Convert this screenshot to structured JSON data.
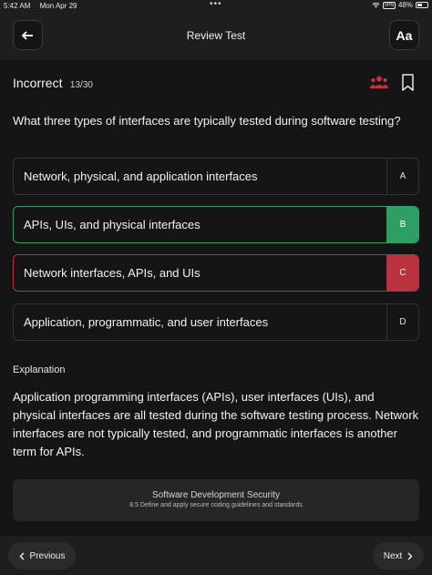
{
  "status_bar": {
    "time": "5:42 AM",
    "date": "Mon Apr 29",
    "dots": "•••",
    "vpn": "VPN",
    "battery": "48%"
  },
  "header": {
    "title": "Review Test",
    "back_icon": "arrow-left-icon",
    "font_button_label": "Aa"
  },
  "result": {
    "status": "Incorrect",
    "progress": "13/30",
    "accent_color": "#c4323d"
  },
  "question": {
    "text": "What three types of interfaces are typically tested during software testing?"
  },
  "options": [
    {
      "letter": "A",
      "text": "Network, physical, and application interfaces",
      "state": "neutral"
    },
    {
      "letter": "B",
      "text": "APIs, UIs, and physical interfaces",
      "state": "correct"
    },
    {
      "letter": "C",
      "text": "Network interfaces, APIs, and UIs",
      "state": "selected-wrong"
    },
    {
      "letter": "D",
      "text": "Application, programmatic, and user interfaces",
      "state": "neutral"
    }
  ],
  "colors": {
    "correct": "#2f9e63",
    "wrong": "#b83240",
    "background": "#151515"
  },
  "explanation": {
    "title": "Explanation",
    "body": "Application programming interfaces (APIs), user interfaces (UIs), and physical interfaces are all tested during the software testing process. Network interfaces are not typically tested, and programmatic interfaces is another term for APIs."
  },
  "domain": {
    "name": "Software Development Security",
    "objective": "8.5 Define and apply secure coding guidelines and standards"
  },
  "footer": {
    "prev_label": "Previous",
    "next_label": "Next"
  }
}
